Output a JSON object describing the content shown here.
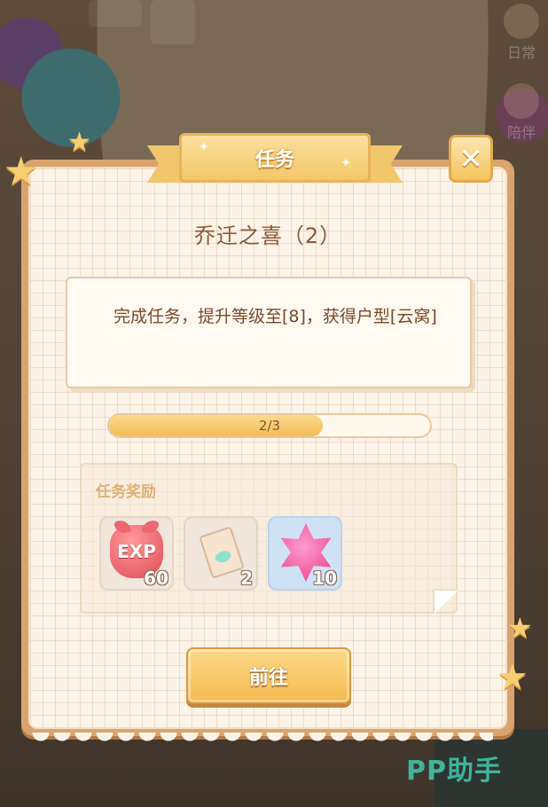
{
  "dialog": {
    "title": "任务",
    "close_symbol": "✕",
    "quest_name": "乔迁之喜（2）",
    "description": "完成任务，提升等级至[8]，获得户型[云窝]",
    "progress": {
      "text": "2/3",
      "current": 2,
      "total": 3
    },
    "reward_label": "任务奖励",
    "rewards": [
      {
        "icon": "exp-icon",
        "text": "EXP",
        "count": "60"
      },
      {
        "icon": "ticket-icon",
        "count": "2"
      },
      {
        "icon": "pink-gem-icon",
        "count": "10"
      }
    ],
    "go_button": "前往"
  },
  "side_menu": {
    "items": [
      {
        "label": "日常"
      },
      {
        "label": "陪伴"
      }
    ]
  },
  "watermark": "PP助手",
  "colors": {
    "accent": "#f4bb50",
    "text_brown": "#7a4a2a",
    "panel": "#fbf3e8"
  }
}
